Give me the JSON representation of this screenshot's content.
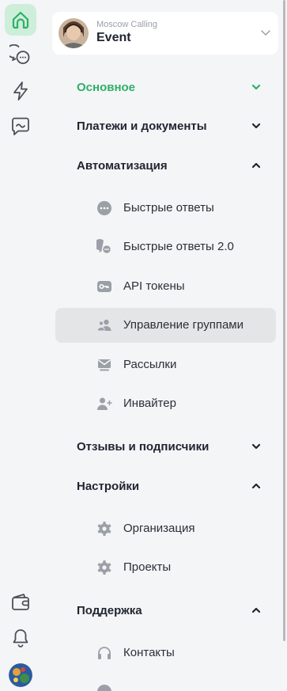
{
  "rail": {
    "items": [
      {
        "icon": "home-icon",
        "active": true
      },
      {
        "icon": "chats-icon",
        "active": false
      },
      {
        "icon": "lightning-icon",
        "active": false
      },
      {
        "icon": "chat-wave-icon",
        "active": false
      }
    ],
    "bottom": [
      {
        "icon": "wallet-icon"
      },
      {
        "icon": "bell-icon"
      },
      {
        "icon": "user-avatar"
      }
    ]
  },
  "workspace": {
    "subtitle": "Moscow Calling",
    "name": "Event"
  },
  "menu": {
    "sections": [
      {
        "label": "Основное",
        "expanded": true,
        "color": "#2eaf69"
      },
      {
        "label": "Платежи и документы",
        "expanded": false
      },
      {
        "label": "Автоматизация",
        "expanded": true,
        "items": [
          {
            "label": "Быстрые ответы",
            "icon": "quick-reply-icon"
          },
          {
            "label": "Быстрые ответы 2.0",
            "icon": "quick-reply-v2-icon"
          },
          {
            "label": "API токены",
            "icon": "api-key-icon"
          },
          {
            "label": "Управление группами",
            "icon": "group-management-icon",
            "active": true
          },
          {
            "label": "Рассылки",
            "icon": "mailing-icon"
          },
          {
            "label": "Инвайтер",
            "icon": "add-user-icon"
          }
        ]
      },
      {
        "label": "Отзывы и подписчики",
        "expanded": false
      },
      {
        "label": "Настройки",
        "expanded": true,
        "items": [
          {
            "label": "Организация",
            "icon": "gear-icon"
          },
          {
            "label": "Проекты",
            "icon": "gear-icon"
          }
        ]
      },
      {
        "label": "Поддержка",
        "expanded": true,
        "items": [
          {
            "label": "Контакты",
            "icon": "headphones-icon"
          }
        ]
      }
    ]
  },
  "colors": {
    "accent": "#2eaf69",
    "accent_bg": "#cdeed9",
    "icon_gray": "#9ba0a8",
    "active_item_bg": "#e4e5e7",
    "page_bg": "#f4f5f7"
  }
}
